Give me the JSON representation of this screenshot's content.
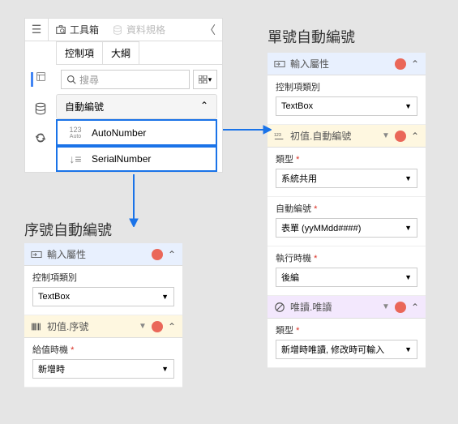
{
  "toolbox": {
    "title": "工具箱",
    "spec": "資料規格",
    "tabs": {
      "control": "控制項",
      "outline": "大綱"
    },
    "search_placeholder": "搜尋",
    "group": "自動編號",
    "items": {
      "auto": {
        "prefix": "123",
        "sub": "Auto",
        "label": "AutoNumber"
      },
      "serial": {
        "label": "SerialNumber"
      }
    }
  },
  "headings": {
    "serial": "序號自動編號",
    "auto": "單號自動編號"
  },
  "serial_panel": {
    "input_section": "輸入屬性",
    "control_type_label": "控制項類別",
    "control_type_value": "TextBox",
    "init_section": "初值.序號",
    "timing_label": "給值時機",
    "timing_value": "新增時"
  },
  "auto_panel": {
    "input_section": "輸入屬性",
    "control_type_label": "控制項類別",
    "control_type_value": "TextBox",
    "init_section": "初值.自動編號",
    "type_label": "類型",
    "type_value": "系統共用",
    "autonum_label": "自動編號",
    "autonum_value": "表單 (yyMMdd####)",
    "exec_label": "執行時機",
    "exec_value": "後編",
    "readonly_section": "唯讀.唯讀",
    "ro_type_label": "類型",
    "ro_type_value": "新增時唯讀, 修改時可輸入"
  }
}
